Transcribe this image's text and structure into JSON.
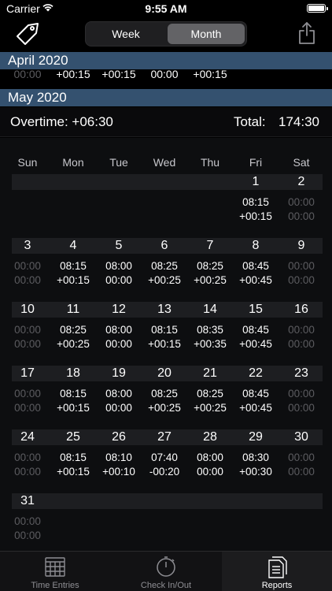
{
  "status_bar": {
    "carrier": "Carrier",
    "time": "9:55 AM"
  },
  "nav": {
    "segments": {
      "week": "Week",
      "month": "Month",
      "selected": "Month"
    }
  },
  "april": {
    "header": "April 2020",
    "partial_row": [
      "00:00",
      "+00:15",
      "+00:15",
      "00:00",
      "+00:15"
    ]
  },
  "may": {
    "header": "May 2020",
    "overtime": "Overtime: +06:30",
    "total_label": "Total:",
    "total_value": "174:30"
  },
  "calendar": {
    "weekdays": [
      "Sun",
      "Mon",
      "Tue",
      "Wed",
      "Thu",
      "Fri",
      "Sat"
    ],
    "weeks": [
      [
        null,
        null,
        null,
        null,
        null,
        {
          "day": "1",
          "hours": "08:15",
          "over": "+00:15"
        },
        {
          "day": "2",
          "hours": "00:00",
          "over": "00:00",
          "dim": true
        }
      ],
      [
        {
          "day": "3",
          "hours": "00:00",
          "over": "00:00",
          "dim": true
        },
        {
          "day": "4",
          "hours": "08:15",
          "over": "+00:15"
        },
        {
          "day": "5",
          "hours": "08:00",
          "over": "00:00"
        },
        {
          "day": "6",
          "hours": "08:25",
          "over": "+00:25"
        },
        {
          "day": "7",
          "hours": "08:25",
          "over": "+00:25"
        },
        {
          "day": "8",
          "hours": "08:45",
          "over": "+00:45"
        },
        {
          "day": "9",
          "hours": "00:00",
          "over": "00:00",
          "dim": true
        }
      ],
      [
        {
          "day": "10",
          "hours": "00:00",
          "over": "00:00",
          "dim": true
        },
        {
          "day": "11",
          "hours": "08:25",
          "over": "+00:25"
        },
        {
          "day": "12",
          "hours": "08:00",
          "over": "00:00"
        },
        {
          "day": "13",
          "hours": "08:15",
          "over": "+00:15"
        },
        {
          "day": "14",
          "hours": "08:35",
          "over": "+00:35"
        },
        {
          "day": "15",
          "hours": "08:45",
          "over": "+00:45"
        },
        {
          "day": "16",
          "hours": "00:00",
          "over": "00:00",
          "dim": true
        }
      ],
      [
        {
          "day": "17",
          "hours": "00:00",
          "over": "00:00",
          "dim": true
        },
        {
          "day": "18",
          "hours": "08:15",
          "over": "+00:15"
        },
        {
          "day": "19",
          "hours": "08:00",
          "over": "00:00"
        },
        {
          "day": "20",
          "hours": "08:25",
          "over": "+00:25"
        },
        {
          "day": "21",
          "hours": "08:25",
          "over": "+00:25"
        },
        {
          "day": "22",
          "hours": "08:45",
          "over": "+00:45"
        },
        {
          "day": "23",
          "hours": "00:00",
          "over": "00:00",
          "dim": true
        }
      ],
      [
        {
          "day": "24",
          "hours": "00:00",
          "over": "00:00",
          "dim": true
        },
        {
          "day": "25",
          "hours": "08:15",
          "over": "+00:15"
        },
        {
          "day": "26",
          "hours": "08:10",
          "over": "+00:10"
        },
        {
          "day": "27",
          "hours": "07:40",
          "over": "-00:20"
        },
        {
          "day": "28",
          "hours": "08:00",
          "over": "00:00"
        },
        {
          "day": "29",
          "hours": "08:30",
          "over": "+00:30"
        },
        {
          "day": "30",
          "hours": "00:00",
          "over": "00:00",
          "dim": true
        }
      ],
      [
        {
          "day": "31",
          "hours": "00:00",
          "over": "00:00",
          "dim": true
        },
        null,
        null,
        null,
        null,
        null,
        null
      ]
    ]
  },
  "tabs": [
    {
      "label": "Time Entries",
      "icon": "calendar-icon"
    },
    {
      "label": "Check In/Out",
      "icon": "stopwatch-icon"
    },
    {
      "label": "Reports",
      "icon": "reports-icon",
      "selected": true
    }
  ],
  "colors": {
    "section_header": "#34516f",
    "dim_text": "#5c5c60",
    "selected_segment": "#636366"
  }
}
